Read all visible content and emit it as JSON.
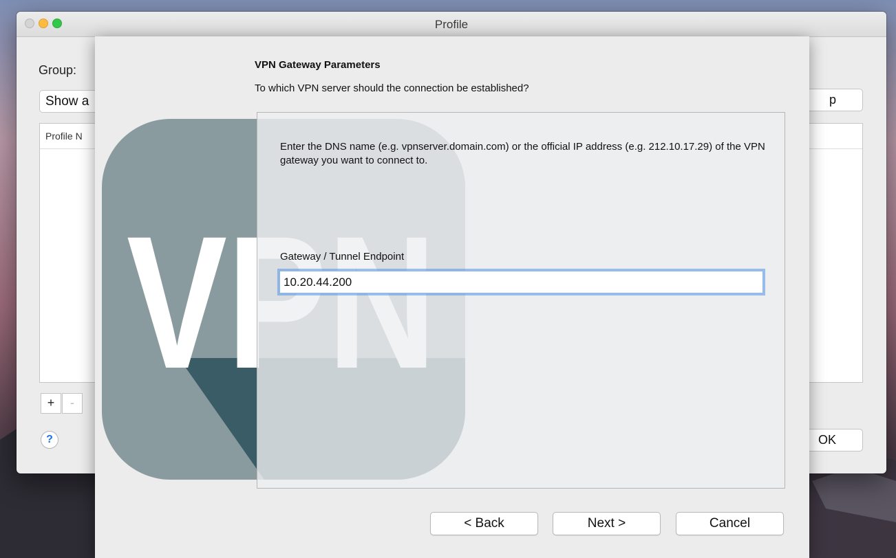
{
  "window": {
    "title": "Profile"
  },
  "background": {
    "group_label": "Group:",
    "group_select_value": "Show a",
    "list_column_header": "Profile N",
    "add_button": "+",
    "remove_button": "-",
    "help_button": "?",
    "right_top_button": "p",
    "ok_button": "OK"
  },
  "wizard": {
    "section_title": "VPN Gateway Parameters",
    "section_subtitle": "To which VPN server should the connection be established?",
    "description": "Enter the DNS name (e.g. vpnserver.domain.com) or the official IP address (e.g. 212.10.17.29) of the VPN gateway you want to connect to.",
    "field_label": "Gateway / Tunnel Endpoint",
    "field_value": "10.20.44.200",
    "logo_text": "VPN",
    "buttons": {
      "back": "< Back",
      "next": "Next >",
      "cancel": "Cancel"
    }
  },
  "colors": {
    "logo_bg": "#8a9ba0",
    "logo_dark": "#3a5c66",
    "focus_ring": "#5296e6"
  }
}
